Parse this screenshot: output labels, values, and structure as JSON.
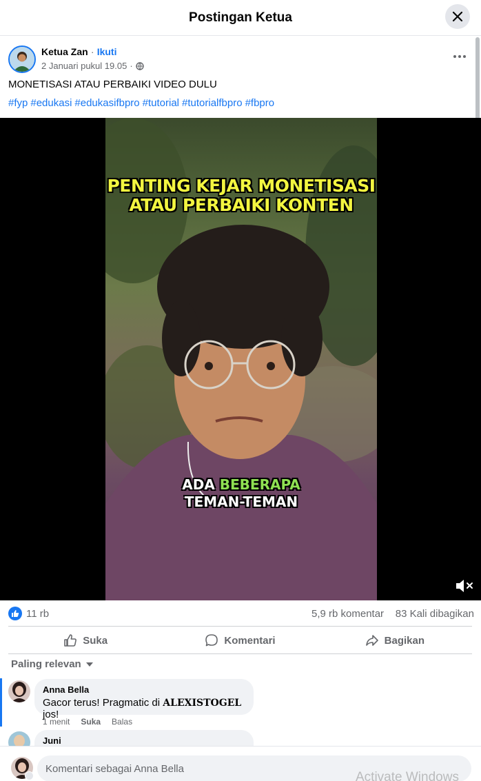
{
  "header": {
    "title": "Postingan Ketua",
    "close_icon": "close-icon"
  },
  "post": {
    "author": "Ketua Zan",
    "separator": "·",
    "follow_label": "Ikuti",
    "date": "2 Januari pukul 19.05",
    "meta_separator": "·",
    "privacy_icon": "globe-icon",
    "more_icon": "more-horizontal-icon",
    "text": "MONETISASI ATAU PERBAIKI VIDEO DULU",
    "hashtags": [
      "#fyp",
      "#edukasi",
      "#edukasifbpro",
      "#tutorial",
      "#tutorialfbpro",
      "#fbpro"
    ]
  },
  "video": {
    "caption_top_line1": "PENTING KEJAR MONETISASI",
    "caption_top_line2": "ATAU PERBAIKI KONTEN",
    "caption_bottom_word1": "ADA",
    "caption_bottom_word2": "BEBERAPA",
    "caption_bottom_line2": "TEMAN-TEMAN",
    "mute_icon": "volume-muted-icon"
  },
  "stats": {
    "likes": "11 rb",
    "comments": "5,9 rb komentar",
    "shares": "83 Kali dibagikan"
  },
  "actions": {
    "like": "Suka",
    "comment": "Komentari",
    "share": "Bagikan"
  },
  "sort_label": "Paling relevan",
  "comments": [
    {
      "name": "Anna Bella",
      "text_before": "Gacor terus! Pragmatic di ",
      "text_bold": "ALEXISTOGEL",
      "text_after": " jos!",
      "time": "1 menit",
      "like": "Suka",
      "reply": "Balas"
    },
    {
      "name": "Juni"
    }
  ],
  "composer": {
    "placeholder": "Komentari sebagai Anna Bella"
  },
  "watermark": "Activate Windows",
  "colors": {
    "accent": "#1877f2",
    "caption_yellow": "#f2f540",
    "caption_green": "#8fe052"
  }
}
